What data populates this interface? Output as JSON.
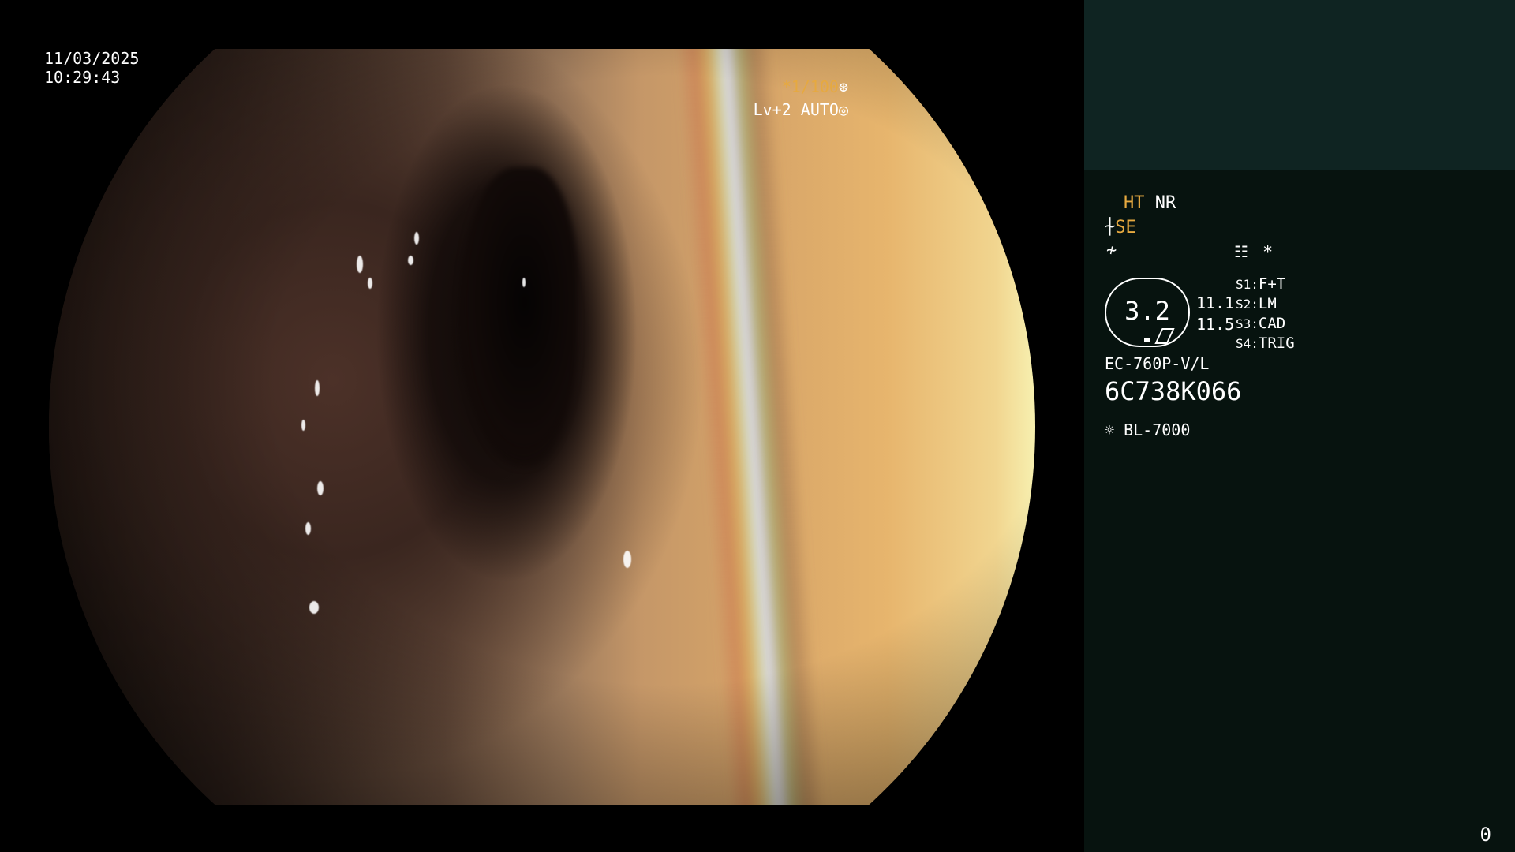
{
  "overlay": {
    "date": "11/03/2025",
    "time": "10:29:43",
    "shutter": "*1/100",
    "shutter_icon": "aperture-icon",
    "level": "Lv+2 AUTO",
    "level_icon": "iris-icon"
  },
  "panel": {
    "ht": "HT",
    "nr": "NR",
    "se": "SE",
    "se_icon": "scope-icon",
    "freeze_icon": "freeze-icon",
    "grid_icon": "menu-grid-icon",
    "star": "*",
    "badge_value": "3.2",
    "readout_1": "11.1",
    "readout_2": "11.5",
    "switches": [
      {
        "key": "S1:",
        "value": "F+T"
      },
      {
        "key": "S2:",
        "value": "LM"
      },
      {
        "key": "S3:",
        "value": "CAD"
      },
      {
        "key": "S4:",
        "value": "TRIG"
      }
    ],
    "scope_model": "EC-760P-V/L",
    "serial": "6C738K066",
    "light_icon": "light-source-icon",
    "light_model": "BL-7000",
    "corner_number": "0"
  },
  "colors": {
    "accent": "#e6a940",
    "panel_bg": "#07130f",
    "panel_top": "#0f2422"
  }
}
